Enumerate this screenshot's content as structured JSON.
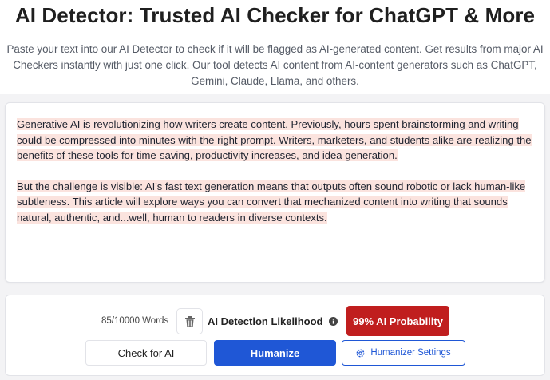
{
  "header": {
    "title": "AI Detector: Trusted AI Checker for ChatGPT & More",
    "subtitle": "Paste your text into our AI Detector to check if it will be flagged as AI-generated content. Get results from major AI Checkers instantly with just one click. Our tool detects AI content from AI-content generators such as ChatGPT, Gemini, Claude, Llama, and others."
  },
  "editor": {
    "paragraphs": [
      "Generative AI is revolutionizing how writers create content. Previously, hours spent brainstorming and writing could be compressed into minutes with the right prompt. Writers, marketers, and students alike are realizing the benefits of these tools for time-saving, productivity increases, and idea generation.",
      " But the challenge is visible: AI's fast text generation means that outputs often sound robotic or lack human-like subtleness. This article will explore ways you can convert that mechanized content into writing that sounds natural, authentic, and...well, human to readers in diverse contexts."
    ],
    "highlight_color": "#fbe3de"
  },
  "controls": {
    "word_count": "85/10000 Words",
    "delete_icon": "trash-icon",
    "likelihood_label": "AI Detection Likelihood",
    "info_icon": "info-icon",
    "probability_badge": "99% AI Probability",
    "probability_color": "#c01e1e",
    "check_button": "Check for AI",
    "humanize_button": "Humanize",
    "settings_button": "Humanizer Settings",
    "settings_icon": "gear-icon",
    "accent_color": "#1f57d6"
  }
}
